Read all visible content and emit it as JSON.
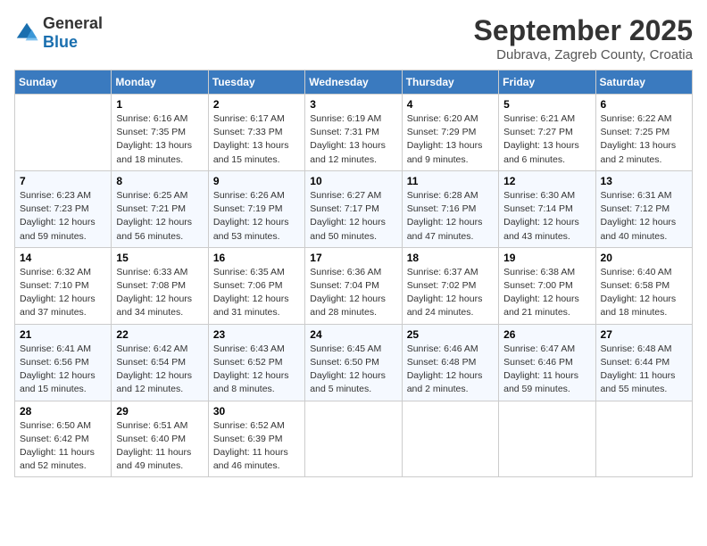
{
  "logo": {
    "general": "General",
    "blue": "Blue"
  },
  "header": {
    "month": "September 2025",
    "location": "Dubrava, Zagreb County, Croatia"
  },
  "weekdays": [
    "Sunday",
    "Monday",
    "Tuesday",
    "Wednesday",
    "Thursday",
    "Friday",
    "Saturday"
  ],
  "weeks": [
    [
      {
        "day": "",
        "info": ""
      },
      {
        "day": "1",
        "info": "Sunrise: 6:16 AM\nSunset: 7:35 PM\nDaylight: 13 hours\nand 18 minutes."
      },
      {
        "day": "2",
        "info": "Sunrise: 6:17 AM\nSunset: 7:33 PM\nDaylight: 13 hours\nand 15 minutes."
      },
      {
        "day": "3",
        "info": "Sunrise: 6:19 AM\nSunset: 7:31 PM\nDaylight: 13 hours\nand 12 minutes."
      },
      {
        "day": "4",
        "info": "Sunrise: 6:20 AM\nSunset: 7:29 PM\nDaylight: 13 hours\nand 9 minutes."
      },
      {
        "day": "5",
        "info": "Sunrise: 6:21 AM\nSunset: 7:27 PM\nDaylight: 13 hours\nand 6 minutes."
      },
      {
        "day": "6",
        "info": "Sunrise: 6:22 AM\nSunset: 7:25 PM\nDaylight: 13 hours\nand 2 minutes."
      }
    ],
    [
      {
        "day": "7",
        "info": "Sunrise: 6:23 AM\nSunset: 7:23 PM\nDaylight: 12 hours\nand 59 minutes."
      },
      {
        "day": "8",
        "info": "Sunrise: 6:25 AM\nSunset: 7:21 PM\nDaylight: 12 hours\nand 56 minutes."
      },
      {
        "day": "9",
        "info": "Sunrise: 6:26 AM\nSunset: 7:19 PM\nDaylight: 12 hours\nand 53 minutes."
      },
      {
        "day": "10",
        "info": "Sunrise: 6:27 AM\nSunset: 7:17 PM\nDaylight: 12 hours\nand 50 minutes."
      },
      {
        "day": "11",
        "info": "Sunrise: 6:28 AM\nSunset: 7:16 PM\nDaylight: 12 hours\nand 47 minutes."
      },
      {
        "day": "12",
        "info": "Sunrise: 6:30 AM\nSunset: 7:14 PM\nDaylight: 12 hours\nand 43 minutes."
      },
      {
        "day": "13",
        "info": "Sunrise: 6:31 AM\nSunset: 7:12 PM\nDaylight: 12 hours\nand 40 minutes."
      }
    ],
    [
      {
        "day": "14",
        "info": "Sunrise: 6:32 AM\nSunset: 7:10 PM\nDaylight: 12 hours\nand 37 minutes."
      },
      {
        "day": "15",
        "info": "Sunrise: 6:33 AM\nSunset: 7:08 PM\nDaylight: 12 hours\nand 34 minutes."
      },
      {
        "day": "16",
        "info": "Sunrise: 6:35 AM\nSunset: 7:06 PM\nDaylight: 12 hours\nand 31 minutes."
      },
      {
        "day": "17",
        "info": "Sunrise: 6:36 AM\nSunset: 7:04 PM\nDaylight: 12 hours\nand 28 minutes."
      },
      {
        "day": "18",
        "info": "Sunrise: 6:37 AM\nSunset: 7:02 PM\nDaylight: 12 hours\nand 24 minutes."
      },
      {
        "day": "19",
        "info": "Sunrise: 6:38 AM\nSunset: 7:00 PM\nDaylight: 12 hours\nand 21 minutes."
      },
      {
        "day": "20",
        "info": "Sunrise: 6:40 AM\nSunset: 6:58 PM\nDaylight: 12 hours\nand 18 minutes."
      }
    ],
    [
      {
        "day": "21",
        "info": "Sunrise: 6:41 AM\nSunset: 6:56 PM\nDaylight: 12 hours\nand 15 minutes."
      },
      {
        "day": "22",
        "info": "Sunrise: 6:42 AM\nSunset: 6:54 PM\nDaylight: 12 hours\nand 12 minutes."
      },
      {
        "day": "23",
        "info": "Sunrise: 6:43 AM\nSunset: 6:52 PM\nDaylight: 12 hours\nand 8 minutes."
      },
      {
        "day": "24",
        "info": "Sunrise: 6:45 AM\nSunset: 6:50 PM\nDaylight: 12 hours\nand 5 minutes."
      },
      {
        "day": "25",
        "info": "Sunrise: 6:46 AM\nSunset: 6:48 PM\nDaylight: 12 hours\nand 2 minutes."
      },
      {
        "day": "26",
        "info": "Sunrise: 6:47 AM\nSunset: 6:46 PM\nDaylight: 11 hours\nand 59 minutes."
      },
      {
        "day": "27",
        "info": "Sunrise: 6:48 AM\nSunset: 6:44 PM\nDaylight: 11 hours\nand 55 minutes."
      }
    ],
    [
      {
        "day": "28",
        "info": "Sunrise: 6:50 AM\nSunset: 6:42 PM\nDaylight: 11 hours\nand 52 minutes."
      },
      {
        "day": "29",
        "info": "Sunrise: 6:51 AM\nSunset: 6:40 PM\nDaylight: 11 hours\nand 49 minutes."
      },
      {
        "day": "30",
        "info": "Sunrise: 6:52 AM\nSunset: 6:39 PM\nDaylight: 11 hours\nand 46 minutes."
      },
      {
        "day": "",
        "info": ""
      },
      {
        "day": "",
        "info": ""
      },
      {
        "day": "",
        "info": ""
      },
      {
        "day": "",
        "info": ""
      }
    ]
  ]
}
